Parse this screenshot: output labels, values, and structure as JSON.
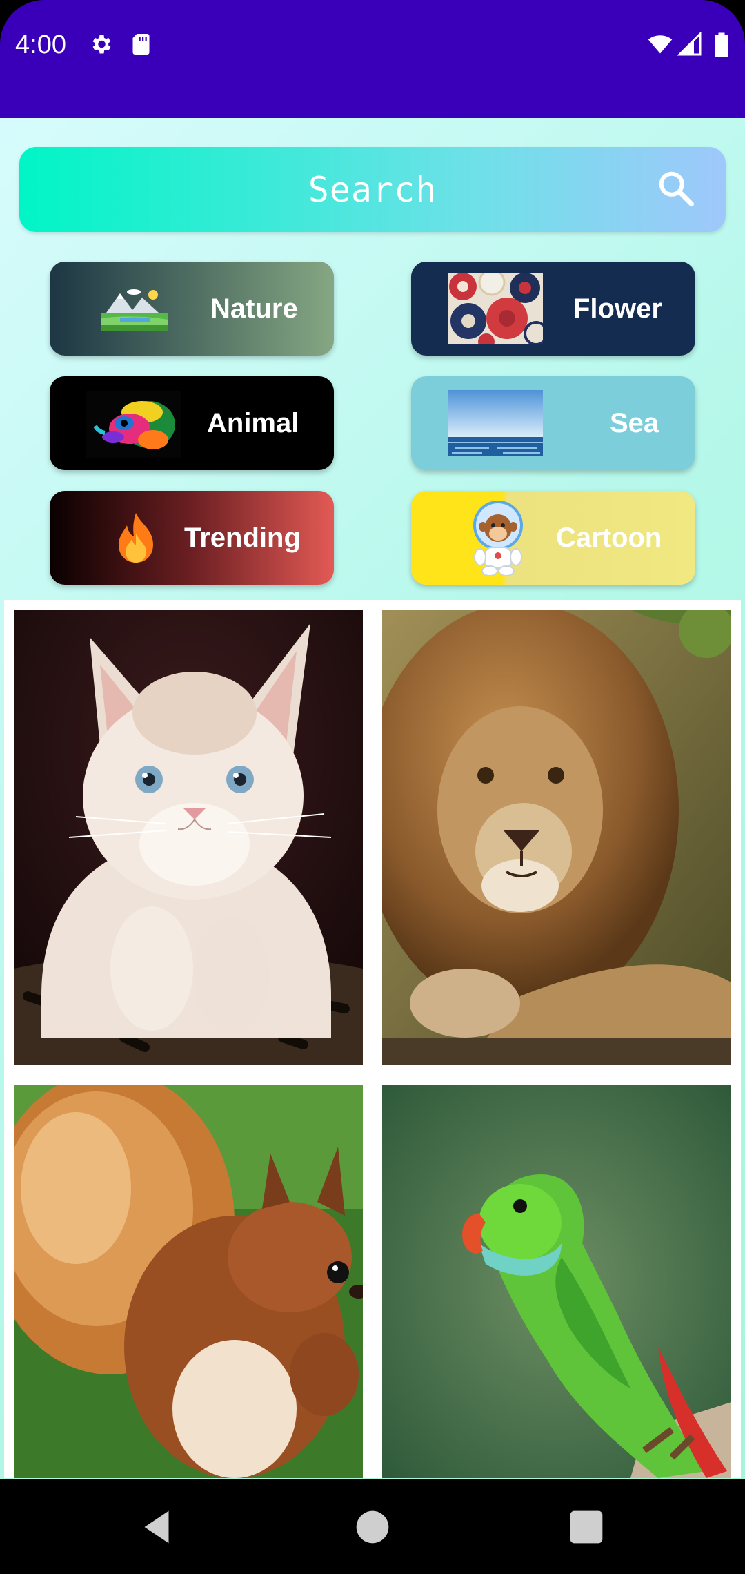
{
  "status_bar": {
    "time": "4:00",
    "left_icons": [
      "gear-icon",
      "sd-card-icon"
    ],
    "right_icons": [
      "wifi-icon",
      "signal-icon",
      "battery-icon"
    ],
    "background": "#3a00b9"
  },
  "search": {
    "label": "Search",
    "icon": "search-icon"
  },
  "categories": [
    {
      "label": "Nature",
      "icon": "landscape-icon"
    },
    {
      "label": "Flower",
      "icon": "flower-pattern-image"
    },
    {
      "label": "Animal",
      "icon": "chameleon-image"
    },
    {
      "label": "Sea",
      "icon": "sea-image"
    },
    {
      "label": "Trending",
      "icon": "fire-icon"
    },
    {
      "label": "Cartoon",
      "icon": "astronaut-monkey-image"
    }
  ],
  "gallery": [
    {
      "name": "kitten-photo"
    },
    {
      "name": "lion-photo"
    },
    {
      "name": "squirrel-photo"
    },
    {
      "name": "parrot-photo"
    }
  ],
  "nav_bar": {
    "buttons": [
      "back-icon",
      "home-icon",
      "recents-icon"
    ]
  }
}
